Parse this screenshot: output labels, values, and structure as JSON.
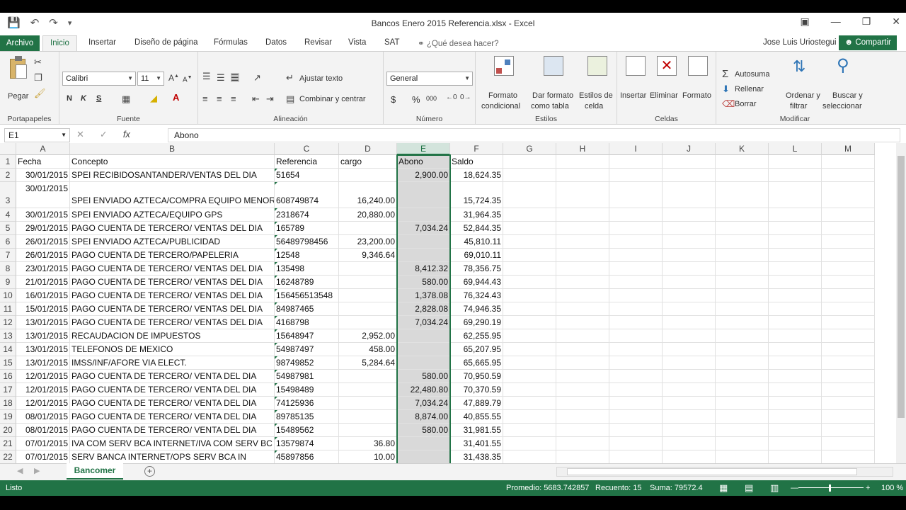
{
  "window": {
    "title": "Bancos Enero 2015 Referencia.xlsx - Excel",
    "user": "Jose Luis Uriostegui",
    "share_label": "Compartir"
  },
  "tabs": [
    {
      "label": "Archivo"
    },
    {
      "label": "Inicio"
    },
    {
      "label": "Insertar"
    },
    {
      "label": "Diseño de página"
    },
    {
      "label": "Fórmulas"
    },
    {
      "label": "Datos"
    },
    {
      "label": "Revisar"
    },
    {
      "label": "Vista"
    },
    {
      "label": "SAT"
    }
  ],
  "tell_me": "¿Qué desea hacer?",
  "ribbon": {
    "portapapeles": {
      "label": "Portapapeles",
      "paste": "Pegar"
    },
    "fuente": {
      "label": "Fuente",
      "font": "Calibri",
      "size": "11",
      "bold": "N",
      "italic": "K",
      "underline": "S"
    },
    "alineacion": {
      "label": "Alineación",
      "wrap": "Ajustar texto",
      "merge": "Combinar y centrar"
    },
    "numero": {
      "label": "Número",
      "format": "General",
      "currency": "$",
      "percent": "%",
      "thousands": "000"
    },
    "estilos": {
      "label": "Estilos",
      "cond1": "Formato",
      "cond2": "condicional",
      "table1": "Dar formato",
      "table2": "como tabla",
      "cell1": "Estilos de",
      "cell2": "celda"
    },
    "celdas": {
      "label": "Celdas",
      "insert": "Insertar",
      "delete": "Eliminar",
      "format": "Formato"
    },
    "modificar": {
      "label": "Modificar",
      "autosum": "Autosuma",
      "fill": "Rellenar",
      "clear": "Borrar",
      "sort1": "Ordenar y",
      "sort2": "filtrar",
      "find1": "Buscar y",
      "find2": "seleccionar"
    }
  },
  "formula_bar": {
    "name_box": "E1",
    "fx": "fx",
    "content": "Abono"
  },
  "columns": [
    "A",
    "B",
    "C",
    "D",
    "E",
    "F",
    "G",
    "H",
    "I",
    "J",
    "K",
    "L",
    "M"
  ],
  "headers": [
    "Fecha",
    "Concepto",
    "Referencia",
    "cargo",
    "Abono",
    "Saldo"
  ],
  "rows": [
    {
      "n": "2",
      "fecha": "30/01/2015",
      "concepto": "SPEI RECIBIDOSANTANDER/VENTAS DEL DIA",
      "ref": "51654",
      "cargo": "",
      "abono": "2,900.00",
      "saldo": "18,624.35"
    },
    {
      "n": "3",
      "fecha": "30/01/2015",
      "concepto": "SPEI ENVIADO AZTECA/COMPRA EQUIPO MENOR",
      "ref": "608749874",
      "cargo": "16,240.00",
      "abono": "",
      "saldo": "15,724.35"
    },
    {
      "n": "4",
      "fecha": "30/01/2015",
      "concepto": "SPEI ENVIADO AZTECA/EQUIPO GPS",
      "ref": "2318674",
      "cargo": "20,880.00",
      "abono": "",
      "saldo": "31,964.35"
    },
    {
      "n": "5",
      "fecha": "29/01/2015",
      "concepto": "PAGO CUENTA DE TERCERO/ VENTAS DEL DIA",
      "ref": "165789",
      "cargo": "",
      "abono": "7,034.24",
      "saldo": "52,844.35"
    },
    {
      "n": "6",
      "fecha": "26/01/2015",
      "concepto": "SPEI ENVIADO AZTECA/PUBLICIDAD",
      "ref": "56489798456",
      "cargo": "23,200.00",
      "abono": "",
      "saldo": "45,810.11"
    },
    {
      "n": "7",
      "fecha": "26/01/2015",
      "concepto": "PAGO CUENTA DE TERCERO/PAPELERIA",
      "ref": "12548",
      "cargo": "9,346.64",
      "abono": "",
      "saldo": "69,010.11"
    },
    {
      "n": "8",
      "fecha": "23/01/2015",
      "concepto": "PAGO CUENTA DE TERCERO/ VENTAS DEL DIA",
      "ref": "135498",
      "cargo": "",
      "abono": "8,412.32",
      "saldo": "78,356.75"
    },
    {
      "n": "9",
      "fecha": "21/01/2015",
      "concepto": "PAGO CUENTA DE TERCERO/ VENTAS DEL DIA",
      "ref": "16248789",
      "cargo": "",
      "abono": "580.00",
      "saldo": "69,944.43"
    },
    {
      "n": "10",
      "fecha": "16/01/2015",
      "concepto": "PAGO CUENTA DE TERCERO/ VENTAS DEL DIA",
      "ref": "156456513548",
      "cargo": "",
      "abono": "1,378.08",
      "saldo": "76,324.43"
    },
    {
      "n": "11",
      "fecha": "15/01/2015",
      "concepto": "PAGO CUENTA DE TERCERO/ VENTAS DEL DIA",
      "ref": "84987465",
      "cargo": "",
      "abono": "2,828.08",
      "saldo": "74,946.35"
    },
    {
      "n": "12",
      "fecha": "13/01/2015",
      "concepto": "PAGO CUENTA DE TERCERO/ VENTAS DEL DIA",
      "ref": "4168798",
      "cargo": "",
      "abono": "7,034.24",
      "saldo": "69,290.19"
    },
    {
      "n": "13",
      "fecha": "13/01/2015",
      "concepto": "RECAUDACION DE IMPUESTOS",
      "ref": "15648947",
      "cargo": "2,952.00",
      "abono": "",
      "saldo": "62,255.95"
    },
    {
      "n": "14",
      "fecha": "13/01/2015",
      "concepto": "TELEFONOS DE MEXICO",
      "ref": "54987497",
      "cargo": "458.00",
      "abono": "",
      "saldo": "65,207.95"
    },
    {
      "n": "15",
      "fecha": "13/01/2015",
      "concepto": "IMSS/INF/AFORE VIA ELECT.",
      "ref": "98749852",
      "cargo": "5,284.64",
      "abono": "",
      "saldo": "65,665.95"
    },
    {
      "n": "16",
      "fecha": "12/01/2015",
      "concepto": "PAGO CUENTA DE TERCERO/ VENTA DEL DIA",
      "ref": "54987981",
      "cargo": "",
      "abono": "580.00",
      "saldo": "70,950.59"
    },
    {
      "n": "17",
      "fecha": "12/01/2015",
      "concepto": "PAGO CUENTA DE TERCERO/ VENTA DEL DIA",
      "ref": "15498489",
      "cargo": "",
      "abono": "22,480.80",
      "saldo": "70,370.59"
    },
    {
      "n": "18",
      "fecha": "12/01/2015",
      "concepto": "PAGO CUENTA DE TERCERO/ VENTA DEL DIA",
      "ref": "74125936",
      "cargo": "",
      "abono": "7,034.24",
      "saldo": "47,889.79"
    },
    {
      "n": "19",
      "fecha": "08/01/2015",
      "concepto": "PAGO CUENTA DE TERCERO/ VENTA DEL DIA",
      "ref": "89785135",
      "cargo": "",
      "abono": "8,874.00",
      "saldo": "40,855.55"
    },
    {
      "n": "20",
      "fecha": "08/01/2015",
      "concepto": "PAGO CUENTA DE TERCERO/ VENTA DEL DIA",
      "ref": "15489562",
      "cargo": "",
      "abono": "580.00",
      "saldo": "31,981.55"
    },
    {
      "n": "21",
      "fecha": "07/01/2015",
      "concepto": "IVA COM SERV BCA INTERNET/IVA COM SERV BC",
      "ref": "13579874",
      "cargo": "36.80",
      "abono": "",
      "saldo": "31,401.55"
    },
    {
      "n": "22",
      "fecha": "07/01/2015",
      "concepto": "SERV BANCA INTERNET/OPS SERV BCA IN",
      "ref": "45897856",
      "cargo": "10.00",
      "abono": "",
      "saldo": "31,438.35"
    }
  ],
  "sheet": {
    "name": "Bancomer"
  },
  "status": {
    "ready": "Listo",
    "average": "Promedio: 5683.742857",
    "count": "Recuento: 15",
    "sum": "Suma: 79572.4",
    "zoom": "100 %"
  },
  "colors": {
    "accent": "#217346",
    "selection": "#d9d9d9"
  }
}
